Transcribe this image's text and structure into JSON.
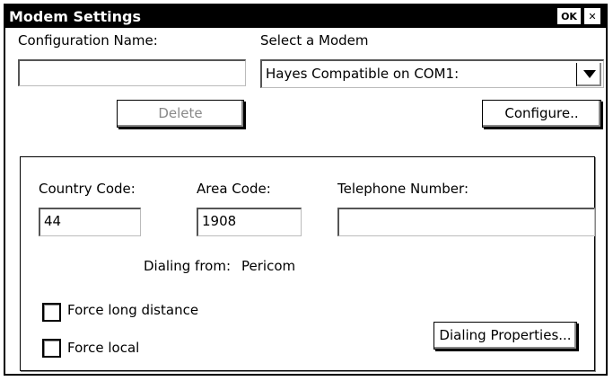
{
  "window": {
    "title": "Modem Settings",
    "ok_button": "OK",
    "close_button": "✕"
  },
  "config": {
    "name_label": "Configuration Name:",
    "name_value": "",
    "delete_button": "Delete"
  },
  "modem": {
    "select_label": "Select a Modem",
    "selected": "Hayes Compatible on COM1:",
    "configure_button": "Configure.."
  },
  "dialing": {
    "country_code_label": "Country Code:",
    "country_code_value": "44",
    "area_code_label": "Area Code:",
    "area_code_value": "1908",
    "telephone_label": "Telephone Number:",
    "telephone_value": "",
    "dialing_from_label": "Dialing from:",
    "dialing_from_value": "Pericom",
    "force_long_distance": {
      "label": "Force long distance",
      "checked": false
    },
    "force_local": {
      "label": "Force local",
      "checked": false
    },
    "properties_button": "Dialing Properties..."
  }
}
